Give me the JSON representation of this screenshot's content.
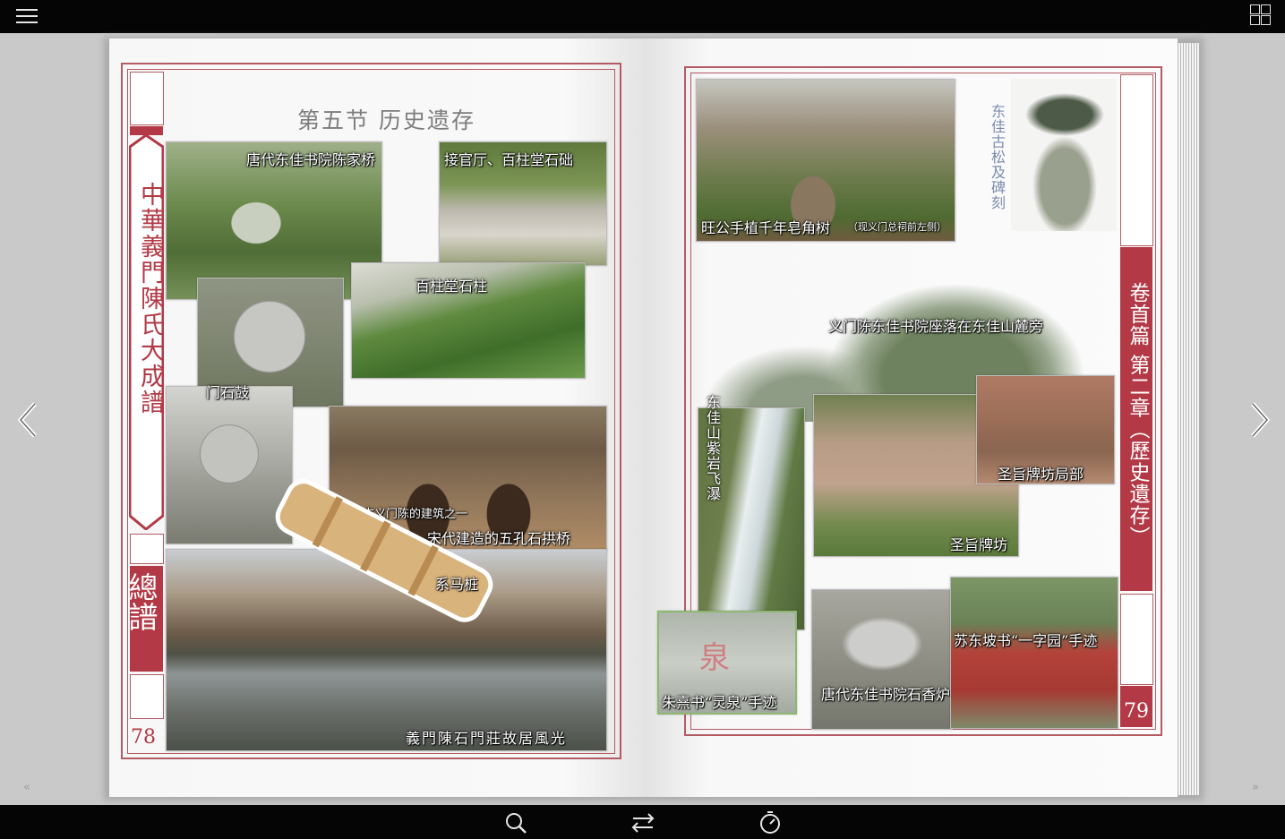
{
  "toolbar": {
    "menu_icon": "hamburger-menu-icon",
    "grid_icon": "thumbnails-grid-icon"
  },
  "navigation": {
    "prev_icon": "chevron-left-icon",
    "next_icon": "chevron-right-icon",
    "first_icon": "double-chevron-left-icon",
    "last_icon": "double-chevron-right-icon"
  },
  "bottom_toolbar": {
    "search_icon": "search-icon",
    "flip_icon": "swap-arrows-icon",
    "autoplay_icon": "timer-icon"
  },
  "left_page": {
    "section_title": "第五节 历史遗存",
    "side_title": "中華義門陳氏大成譜",
    "side_label": "總譜",
    "page_number": "78",
    "captions": {
      "bridge": "唐代东佳书院陈家桥",
      "stone_base": "接官厅、百柱堂石础",
      "pillars": "百柱堂石柱",
      "drum": "门石鼓",
      "arch_bridge_line1": "古义门陈的建筑之一",
      "arch_bridge_line2": "——宋代建造的五孔石拱桥",
      "hitching_post": "系马桩",
      "village": "義門陳石門莊故居風光"
    }
  },
  "right_page": {
    "side_title": "卷首篇 第二章（歷史遺存）",
    "page_number": "79",
    "captions": {
      "old_tree": "旺公手植千年皂角树",
      "old_tree_note": "（现义门总祠前左侧）",
      "pine": "东佳古松及碑刻",
      "mountain": "义门陈东佳书院座落在东佳山麓旁",
      "waterfall": "东佳山紫岩飞瀑",
      "archway_detail": "圣旨牌坊局部",
      "archway": "圣旨牌坊",
      "zhu_xi": "朱熹书“灵泉”手迹",
      "incense_burner": "唐代东佳书院石香炉",
      "su_dongpo": "苏东坡书“一字园”手迹"
    }
  }
}
